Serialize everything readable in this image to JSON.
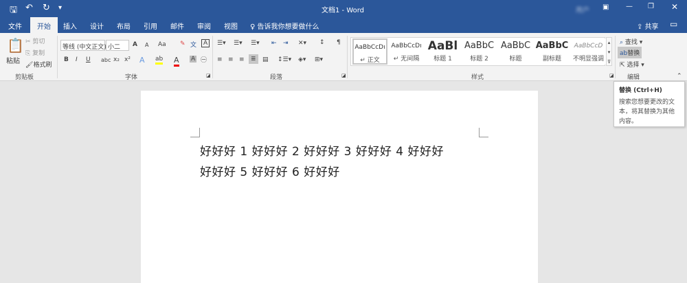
{
  "window": {
    "title": "文档1 - Word",
    "user": "用户"
  },
  "quick_access": {
    "save": "save-icon",
    "undo": "undo-icon",
    "redo": "redo-icon",
    "customize": "▾"
  },
  "tabs": [
    "文件",
    "开始",
    "插入",
    "设计",
    "布局",
    "引用",
    "邮件",
    "审阅",
    "视图"
  ],
  "tell_me": "告诉我你想要做什么",
  "share": "共享",
  "clipboard": {
    "paste": "粘贴",
    "cut": "剪切",
    "copy": "复制",
    "format_painter": "格式刷",
    "label": "剪贴板"
  },
  "font": {
    "name": "等线 (中文正文)",
    "size": "小二",
    "label": "字体",
    "grow": "A",
    "shrink": "A",
    "case": "Aa",
    "bold": "B",
    "italic": "I",
    "underline": "U",
    "strike": "abc",
    "sub": "x₂",
    "sup": "x²"
  },
  "paragraph": {
    "label": "段落"
  },
  "styles": {
    "label": "样式",
    "items": [
      {
        "preview": "AaBbCcDı",
        "name": "↵ 正文"
      },
      {
        "preview": "AaBbCcDı",
        "name": "↵ 无间隔"
      },
      {
        "preview": "AaBl",
        "name": "标题 1"
      },
      {
        "preview": "AaBbC",
        "name": "标题 2"
      },
      {
        "preview": "AaBbC",
        "name": "标题"
      },
      {
        "preview": "AaBbC",
        "name": "副标题"
      },
      {
        "preview": "AaBbCcD",
        "name": "不明显强调"
      }
    ]
  },
  "editing": {
    "find": "查找",
    "replace": "替换",
    "select": "选择",
    "label": "编辑"
  },
  "tooltip": {
    "title": "替换 (Ctrl+H)",
    "body": "搜索您想要更改的文本，将其替换为其他内容。"
  },
  "document": {
    "lines": [
      "好好好 1 好好好 2 好好好 3 好好好 4 好好好",
      "好好好 5 好好好 6 好好好"
    ]
  }
}
